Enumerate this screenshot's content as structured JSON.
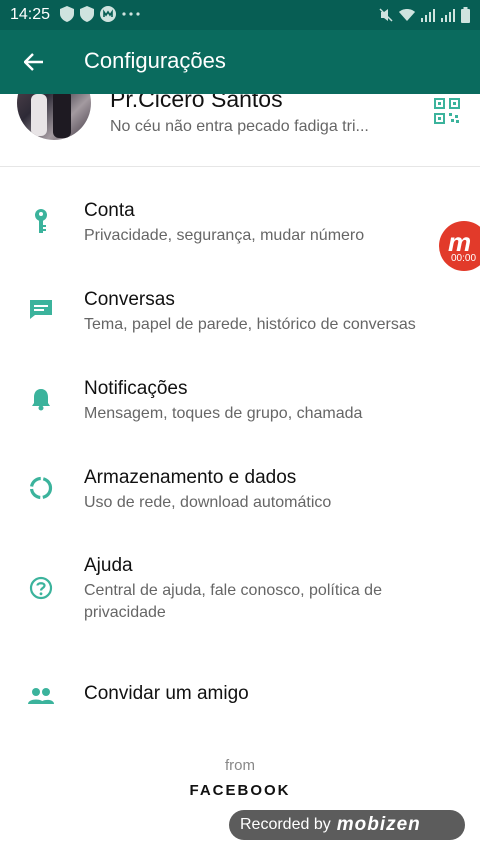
{
  "status_bar": {
    "time": "14:25"
  },
  "app_bar": {
    "title": "Configurações"
  },
  "profile": {
    "name": "Pr.Cicero Santos",
    "status": "No céu não entra pecado fadiga tri..."
  },
  "settings": [
    {
      "title": "Conta",
      "subtitle": "Privacidade, segurança, mudar número",
      "icon": "key-icon"
    },
    {
      "title": "Conversas",
      "subtitle": "Tema, papel de parede, histórico de conversas",
      "icon": "chat-icon"
    },
    {
      "title": "Notificações",
      "subtitle": "Mensagem, toques de grupo, chamada",
      "icon": "bell-icon"
    },
    {
      "title": "Armazenamento e dados",
      "subtitle": "Uso de rede, download automático",
      "icon": "storage-ring-icon"
    },
    {
      "title": "Ajuda",
      "subtitle": "Central de ajuda, fale conosco, política de privacidade",
      "icon": "help-icon"
    },
    {
      "title": "Convidar um amigo",
      "icon": "people-icon"
    }
  ],
  "footer": {
    "from": "from",
    "brand": "FACEBOOK"
  },
  "overlay": {
    "recorded_by": "Recorded by",
    "recorder_logo": "mobizen",
    "floating_button_letter": "m",
    "floating_button_timer": "00:00"
  },
  "colors": {
    "primary": "#075e54",
    "appbar": "#0a6b5e",
    "accent": "#3bb39c",
    "record": "#e23a2a"
  }
}
